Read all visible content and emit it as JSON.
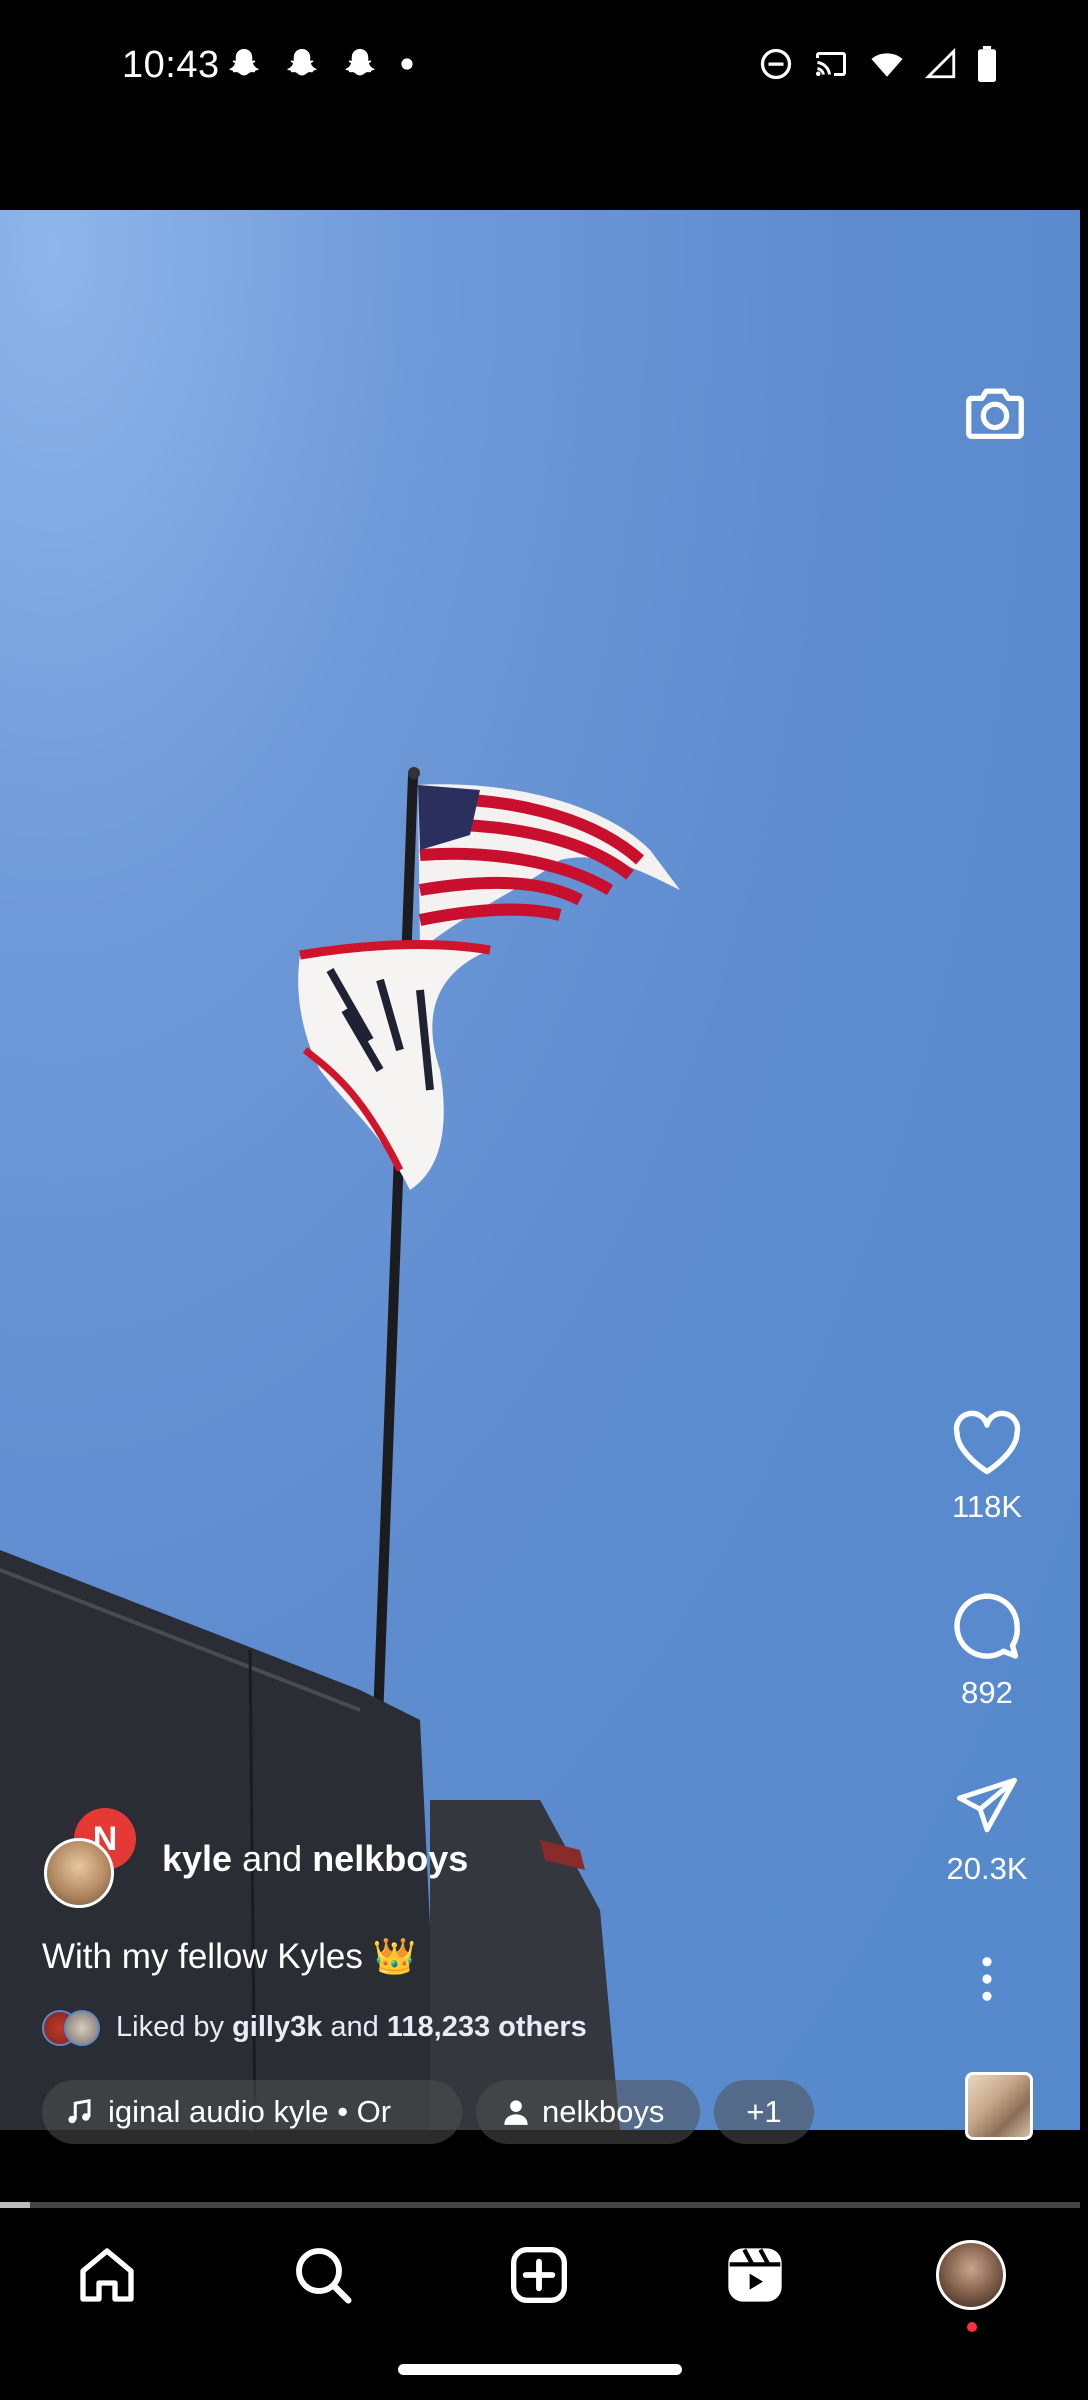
{
  "status_bar": {
    "time": "10:43",
    "left_icons": [
      "snapchat-icon",
      "snapchat-icon",
      "snapchat-icon",
      "dot-icon"
    ],
    "right_icons": [
      "do-not-disturb-icon",
      "cast-icon",
      "wifi-icon",
      "signal-icon",
      "battery-icon"
    ]
  },
  "reel": {
    "camera_icon": "camera-icon",
    "author": {
      "primary": "kyle",
      "joiner": "and",
      "collaborator": "nelkboys",
      "collaborator_badge": "N"
    },
    "caption": "With my fellow Kyles 👑",
    "liked_by": {
      "prefix": "Liked by",
      "user": "gilly3k",
      "joiner": "and",
      "others": "118,233 others"
    },
    "chips": {
      "audio": "iginal audio   kyle • Or",
      "people": "nelkboys",
      "more": "+1"
    },
    "actions": {
      "likes": "118K",
      "comments": "892",
      "shares": "20.3K"
    }
  },
  "nav": {
    "items": [
      "home-icon",
      "search-icon",
      "create-icon",
      "reels-icon",
      "profile-avatar"
    ]
  },
  "colors": {
    "sky": "#5e8ccf",
    "notification_dot": "#ff3040",
    "collab_badge": "#e53935"
  }
}
